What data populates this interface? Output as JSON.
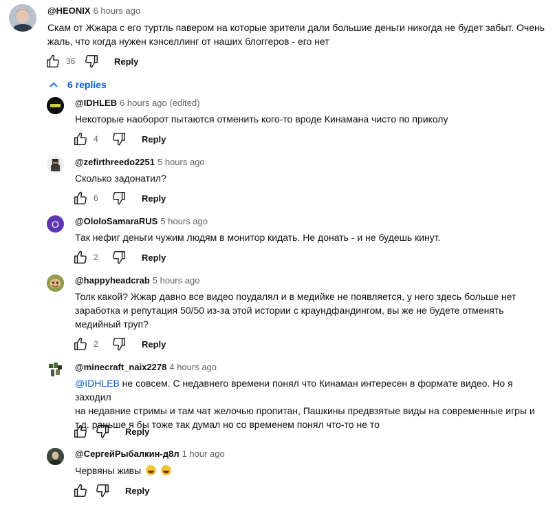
{
  "top_comment": {
    "author": "@HEONIX",
    "time": "6 hours ago",
    "text_line1": "Скам от Жжара с его туртль павером на которые зрители дали большие деньги никогда не будет забыт. Очень",
    "text_line2": "жаль, что когда нужен кэнселлинг от наших блоггеров - его нет",
    "likes": "36",
    "reply_label": "Reply"
  },
  "replies_toggle": {
    "icon": "chevron-up-icon",
    "label": "6 replies"
  },
  "replies": [
    {
      "author": "@IDHLEB",
      "time": "6 hours ago (edited)",
      "lines": [
        "Некоторые наоборот пытаются отменить кого-то вроде Кинамана чисто по приколу"
      ],
      "likes": "4",
      "reply_label": "Reply",
      "avatar_color": "#111111"
    },
    {
      "author": "@zefirthreedo2251",
      "time": "5 hours ago",
      "lines": [
        "Сколько задонатил?"
      ],
      "likes": "6",
      "reply_label": "Reply",
      "avatar_color": "#e8e8e8"
    },
    {
      "author": "@OloloSamaraRUS",
      "time": "5 hours ago",
      "avatar_letter": "O",
      "lines": [
        "Так нефиг деньги чужим людям в монитор кидать. Не донать - и не будешь кинут."
      ],
      "likes": "2",
      "reply_label": "Reply",
      "avatar_color": "#5e35b1"
    },
    {
      "author": "@happyheadcrab",
      "time": "5 hours ago",
      "lines": [
        "Толк какой? Жжар давно все видео поудалял и в медийке не появляется, у него здесь больше нет",
        "заработка и репутация 50/50 из-за этой истории с краундфандингом, вы же не будете отменять",
        "медийный труп?"
      ],
      "likes": "2",
      "reply_label": "Reply",
      "avatar_color": "#7a8a3a"
    },
    {
      "author": "@minecraft_naix2278",
      "time": "4 hours ago",
      "mention": "@IDHLEB",
      "lines": [
        " не совсем. С недавнего времени понял что Кинаман интересен в формате видео. Но я заходил",
        "на недавние стримы и там чат желочью пропитан, Пашкины предвзятые виды на современные игры и",
        "т.д. раньше я бы тоже так думал но со временем понял что-то не то"
      ],
      "likes": "",
      "reply_label": "Reply",
      "avatar_color": "#ffffff"
    },
    {
      "author": "@СергейРыбалкин-д8л",
      "time": "1 hour ago",
      "lines": [
        "Червяны живы"
      ],
      "emojis": [
        "grinning-sweat-emoji",
        "grinning-sweat-emoji"
      ],
      "likes": "",
      "reply_label": "Reply",
      "avatar_color": "#3b4a3a"
    }
  ],
  "colors": {
    "link": "#065fd4",
    "secondary_text": "#606060",
    "primary_text": "#0f0f0f"
  }
}
